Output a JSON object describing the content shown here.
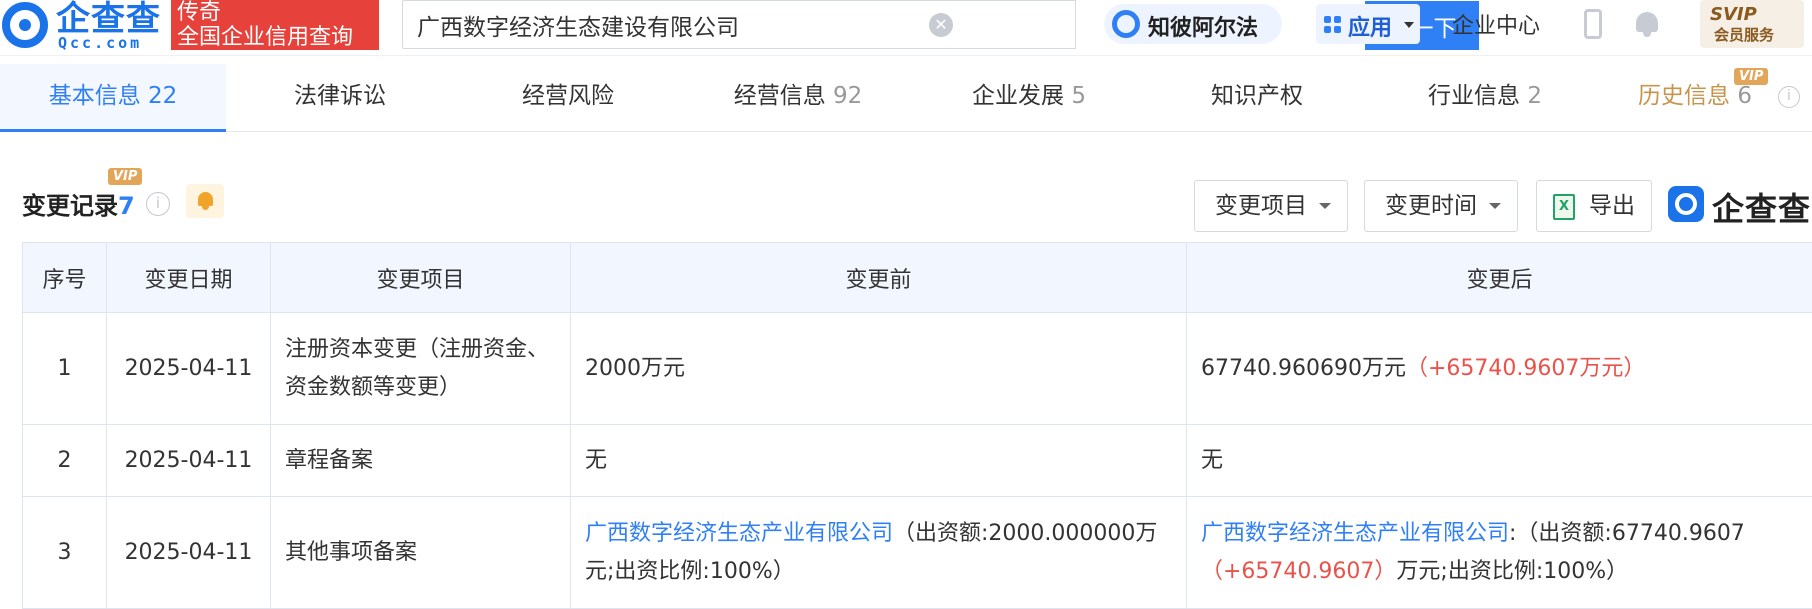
{
  "header": {
    "logo_text": "企查查",
    "logo_sub": "Qcc.com",
    "slogan_line1": "传奇",
    "slogan_line2": "全国企业信用查询",
    "search_value": "广西数字经济生态建设有限公司",
    "search_button": "查一下",
    "alpha_label": "知彼阿尔法",
    "apps_label": "应用",
    "enterprise_center": "企业中心",
    "svip_line1": "SVIP",
    "svip_line2": "会员服务"
  },
  "tabs": [
    {
      "label": "基本信息",
      "count": "22"
    },
    {
      "label": "法律诉讼",
      "count": ""
    },
    {
      "label": "经营风险",
      "count": ""
    },
    {
      "label": "经营信息",
      "count": "92"
    },
    {
      "label": "企业发展",
      "count": "5"
    },
    {
      "label": "知识产权",
      "count": ""
    },
    {
      "label": "行业信息",
      "count": "2"
    },
    {
      "label": "历史信息",
      "count": "6"
    }
  ],
  "tab_vip_badge": "VIP",
  "section": {
    "title": "变更记录",
    "count": "7",
    "vip_badge": "VIP",
    "filter_item": "变更项目",
    "filter_time": "变更时间",
    "export": "导出",
    "watermark": "企查查"
  },
  "table": {
    "headers": [
      "序号",
      "变更日期",
      "变更项目",
      "变更前",
      "变更后"
    ],
    "rows": [
      {
        "no": "1",
        "date": "2025-04-11",
        "item": "注册资本变更（注册资金、资金数额等变更）",
        "before": "2000万元",
        "after": "67740.960690万元",
        "after_delta": "（+65740.9607万元）"
      },
      {
        "no": "2",
        "date": "2025-04-11",
        "item": "章程备案",
        "before": "无",
        "after": "无"
      },
      {
        "no": "3",
        "date": "2025-04-11",
        "item": "其他事项备案",
        "before_link": "广西数字经济生态产业有限公司",
        "before_text": "（出资额:2000.000000万元;出资比例:100%）",
        "after_link": "广西数字经济生态产业有限公司",
        "after_text1": ":（出资额:67740.9607",
        "after_delta": "（+65740.9607）",
        "after_text2": "万元;出资比例:100%）"
      }
    ]
  },
  "colors": {
    "brand_blue": "#2f7ff5",
    "delta_red": "#e9534b",
    "vip_gold": "#e2a65b"
  }
}
